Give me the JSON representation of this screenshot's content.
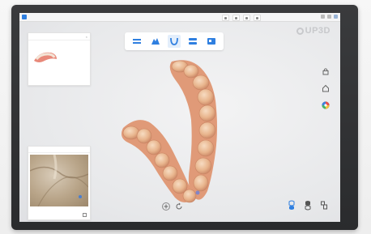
{
  "app": {
    "name": "UP3D",
    "brand": "UP3D"
  },
  "icons": {
    "view_toolbar": [
      "upper-jaw-icon",
      "lower-jaw-icon",
      "arch-view-icon",
      "bite-icon",
      "full-view-icon"
    ],
    "right_tools": [
      "lock-icon",
      "home-icon",
      "color-wheel-icon"
    ],
    "bottom_center": [
      "add-icon",
      "rotate-icon"
    ],
    "bottom_right": [
      "upper-scan-icon",
      "lower-scan-icon",
      "bite-scan-icon"
    ]
  },
  "colors": {
    "accent": "#2f7fe0",
    "bezel": "#2e2f31",
    "screen_bg": "#e9eaec",
    "gum": "#e8897a",
    "tooth": "#e8b48c"
  }
}
